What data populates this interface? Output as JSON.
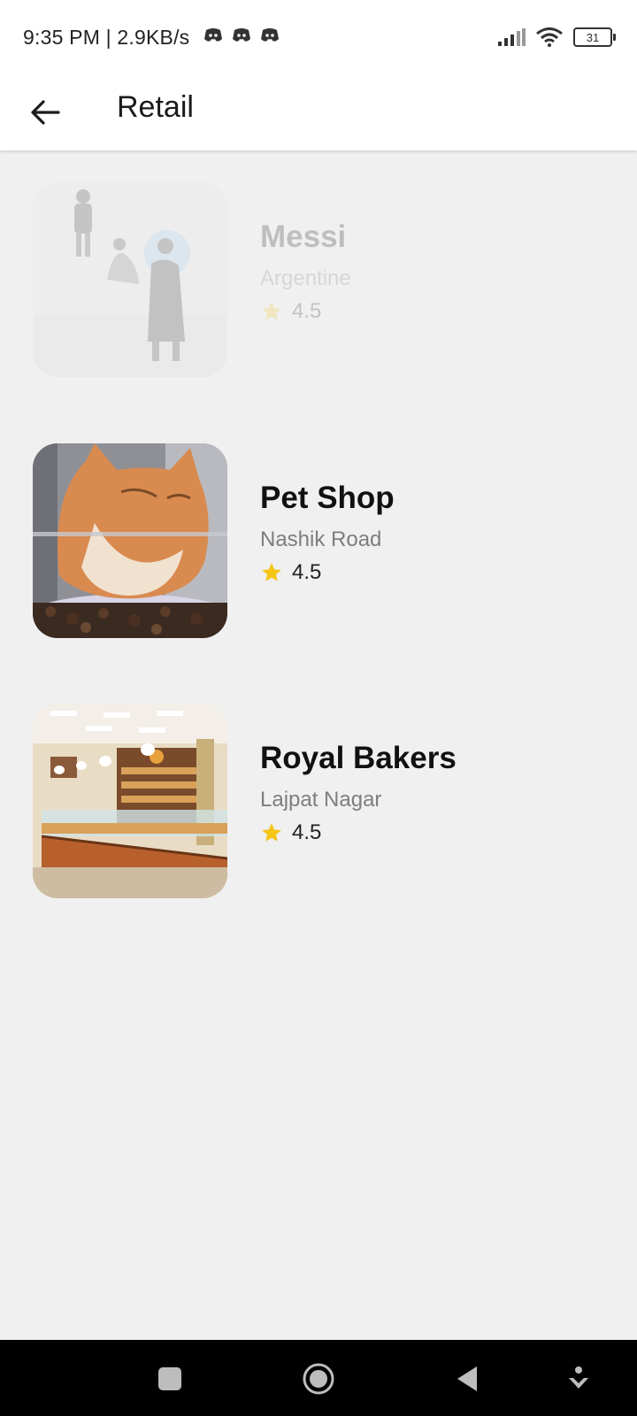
{
  "status": {
    "time": "9:35 PM | 2.9KB/s",
    "battery": "31",
    "icons": [
      "discord-icon",
      "discord-icon",
      "discord-icon",
      "signal-icon",
      "wifi-icon",
      "battery-icon"
    ]
  },
  "appbar": {
    "title": "Retail",
    "back_icon": "arrow-left-icon"
  },
  "items": [
    {
      "name": "Messi",
      "location": "Argentine",
      "rating": "4.5",
      "faded": true
    },
    {
      "name": "Pet Shop",
      "location": "Nashik Road",
      "rating": "4.5"
    },
    {
      "name": "Royal Bakers",
      "location": "Lajpat Nagar",
      "rating": "4.5"
    }
  ],
  "colors": {
    "star": "#F5C518",
    "background": "#F0F0F0",
    "navbar": "#000000"
  },
  "navbar": {
    "icons": [
      "square-icon",
      "circle-icon",
      "triangle-back-icon",
      "download-arrow-icon"
    ]
  }
}
